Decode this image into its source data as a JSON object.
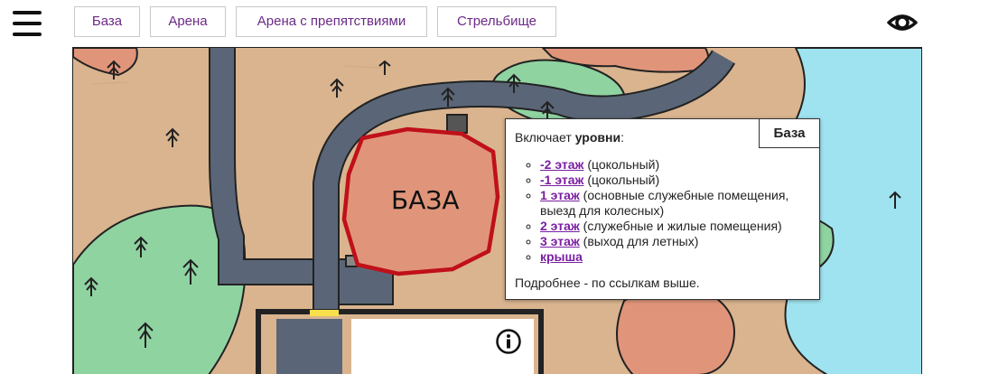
{
  "nav": {
    "tabs": [
      {
        "label": "База"
      },
      {
        "label": "Арена"
      },
      {
        "label": "Арена с препятствиями"
      },
      {
        "label": "Стрельбище"
      }
    ]
  },
  "icons": {
    "menu": "hamburger-menu-icon",
    "visibility": "eye-icon",
    "info": "info-icon"
  },
  "map": {
    "base_label": "БАЗА",
    "colors": {
      "ground": "#d9b48f",
      "forest": "#8fd3a1",
      "water": "#9fe3f0",
      "road": "#5a6677",
      "rock": "#e0957a",
      "outline": "#c0101a"
    }
  },
  "popup": {
    "title": "База",
    "intro_prefix": "Включает",
    "intro_bold": "уровни",
    "intro_suffix": ":",
    "levels": [
      {
        "link": "-2 этаж",
        "desc": " (цокольный)"
      },
      {
        "link": "-1 этаж",
        "desc": " (цокольный)"
      },
      {
        "link": "1 этаж",
        "desc": " (основные служебные помещения, выезд для колесных)"
      },
      {
        "link": "2 этаж",
        "desc": " (служебные и жилые помещения)"
      },
      {
        "link": "3 этаж",
        "desc": " (выход для летных)"
      },
      {
        "link": "крыша",
        "desc": ""
      }
    ],
    "footer": "Подробнее - по ссылкам выше."
  }
}
